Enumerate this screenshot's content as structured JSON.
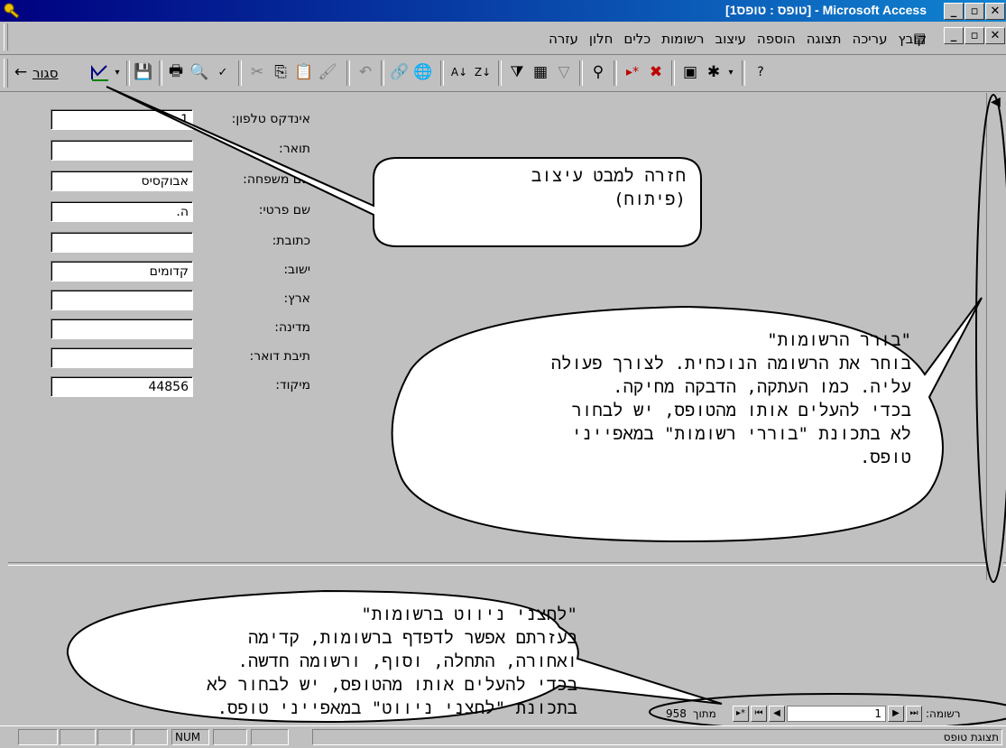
{
  "window": {
    "title": "[טופס : טופס1] - Microsoft Access"
  },
  "menu": [
    "קובץ",
    "עריכה",
    "תצוגה",
    "הוספה",
    "עיצוב",
    "רשומות",
    "כלים",
    "חלון",
    "עזרה"
  ],
  "toolbar": {
    "close_label": "סגור"
  },
  "form": {
    "fields": [
      {
        "label": "אינדקס טלפון:",
        "value": "1"
      },
      {
        "label": "תואר:",
        "value": ""
      },
      {
        "label": "שם משפחה:",
        "value": "אבוקסיס"
      },
      {
        "label": "שם פרטי:",
        "value": "ה."
      },
      {
        "label": "כתובת:",
        "value": ""
      },
      {
        "label": "ישוב:",
        "value": "קדומים"
      },
      {
        "label": "ארץ:",
        "value": ""
      },
      {
        "label": "מדינה:",
        "value": ""
      },
      {
        "label": "תיבת דואר:",
        "value": ""
      },
      {
        "label": "מיקוד:",
        "value": "44856"
      }
    ]
  },
  "callouts": {
    "design_view": [
      "חזרה למבט עיצוב",
      "(פיתוח)"
    ],
    "record_selector": [
      "\"בורר הרשומות\"",
      "בוחר את הרשומה הנוכחית. לצורך פעולה",
      "עליה. כמו העתקה, הדבקה מחיקה.",
      "בכדי להעלים אותו מהטופס, יש לבחור",
      "לא בתכונת \"בוררי רשומות\" במאפייני",
      "טופס."
    ],
    "navigation_buttons": [
      "\"לחצני ניווט ברשומות\"",
      "בעזרתם אפשר לדפדף ברשומות, קדימה",
      "ואחורה, התחלה, וסוף, ורשומה חדשה.",
      "בכדי להעלים אותו מהטופס, יש לבחור לא",
      "בתכונת \"לחצני ניווט\" במאפייני טופס."
    ]
  },
  "navigation": {
    "record_label": "רשומה:",
    "current": "1",
    "of_label": "מתוך",
    "total": "958"
  },
  "status": {
    "view": "תצוגת טופס",
    "num": "NUM"
  }
}
